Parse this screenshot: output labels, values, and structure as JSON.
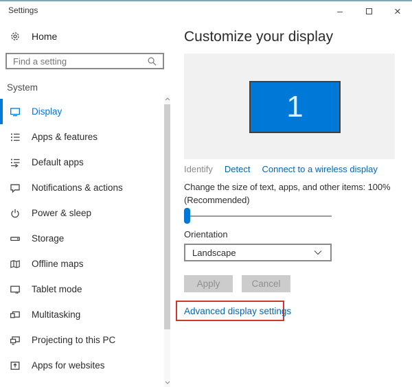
{
  "window": {
    "title": "Settings",
    "controls": {
      "minimize_glyph": "–",
      "close_glyph": "×"
    }
  },
  "sidebar": {
    "home_label": "Home",
    "search": {
      "placeholder": "Find a setting"
    },
    "section_header": "System",
    "items": [
      {
        "label": "Display",
        "icon": "display-icon",
        "selected": true
      },
      {
        "label": "Apps & features",
        "icon": "apps-features-icon",
        "selected": false
      },
      {
        "label": "Default apps",
        "icon": "default-apps-icon",
        "selected": false
      },
      {
        "label": "Notifications & actions",
        "icon": "notifications-icon",
        "selected": false
      },
      {
        "label": "Power & sleep",
        "icon": "power-icon",
        "selected": false
      },
      {
        "label": "Storage",
        "icon": "storage-icon",
        "selected": false
      },
      {
        "label": "Offline maps",
        "icon": "offline-maps-icon",
        "selected": false
      },
      {
        "label": "Tablet mode",
        "icon": "tablet-mode-icon",
        "selected": false
      },
      {
        "label": "Multitasking",
        "icon": "multitasking-icon",
        "selected": false
      },
      {
        "label": "Projecting to this PC",
        "icon": "projecting-icon",
        "selected": false
      },
      {
        "label": "Apps for websites",
        "icon": "apps-websites-icon",
        "selected": false
      }
    ]
  },
  "main": {
    "title": "Customize your display",
    "preview": {
      "monitor_label": "1"
    },
    "links": {
      "identify": "Identify",
      "detect": "Detect",
      "wireless": "Connect to a wireless display"
    },
    "scale_text_line1": "Change the size of text, apps, and other items: 100%",
    "scale_text_line2": "(Recommended)",
    "slider": {
      "value_percent": 0
    },
    "orientation": {
      "label": "Orientation",
      "selected": "Landscape"
    },
    "buttons": {
      "apply": "Apply",
      "cancel": "Cancel"
    },
    "advanced_link": "Advanced display settings"
  },
  "colors": {
    "accent": "#0078d7",
    "link": "#0066b4",
    "annotation_red": "#cd372c",
    "disabled_button_bg": "#cccccc",
    "disabled_button_text": "#8f8f8f",
    "preview_bg": "#f1f1f1",
    "top_border": "#7fa8b3"
  }
}
